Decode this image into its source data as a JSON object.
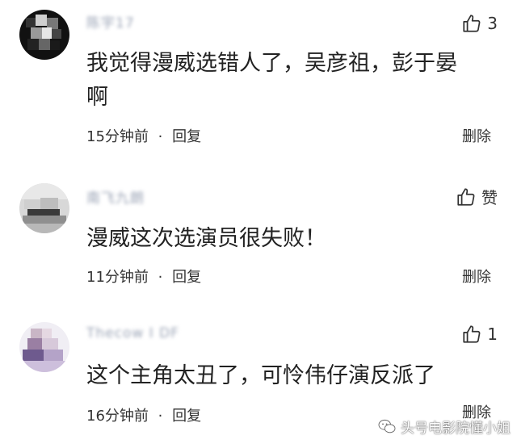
{
  "comments": [
    {
      "username": "陈宇17",
      "like_count": "3",
      "text_line1": "我觉得漫威选错人了，吴彦祖，彭于晏",
      "text_line2": "啊",
      "time": "15分钟前",
      "separator": "·",
      "reply_label": "回复",
      "delete_label": "删除"
    },
    {
      "username": "南飞九朗",
      "like_count": "赞",
      "text_line1": "漫威这次选演员很失败！",
      "time": "11分钟前",
      "separator": "·",
      "reply_label": "回复",
      "delete_label": "删除"
    },
    {
      "username": "Thecow I DF",
      "like_count": "1",
      "text_line1": "这个主角太丑了，可怜伟仔演反派了",
      "time": "16分钟前",
      "separator": "·",
      "reply_label": "回复",
      "delete_label": "删除"
    }
  ],
  "watermark": {
    "text": "头号电影院懂小姐",
    "icon": "wechat-icon"
  },
  "colors": {
    "username_blur": "#9aa3b5",
    "text": "#222222",
    "meta": "#333333"
  },
  "icons": {
    "like": "thumbs-up-icon"
  }
}
